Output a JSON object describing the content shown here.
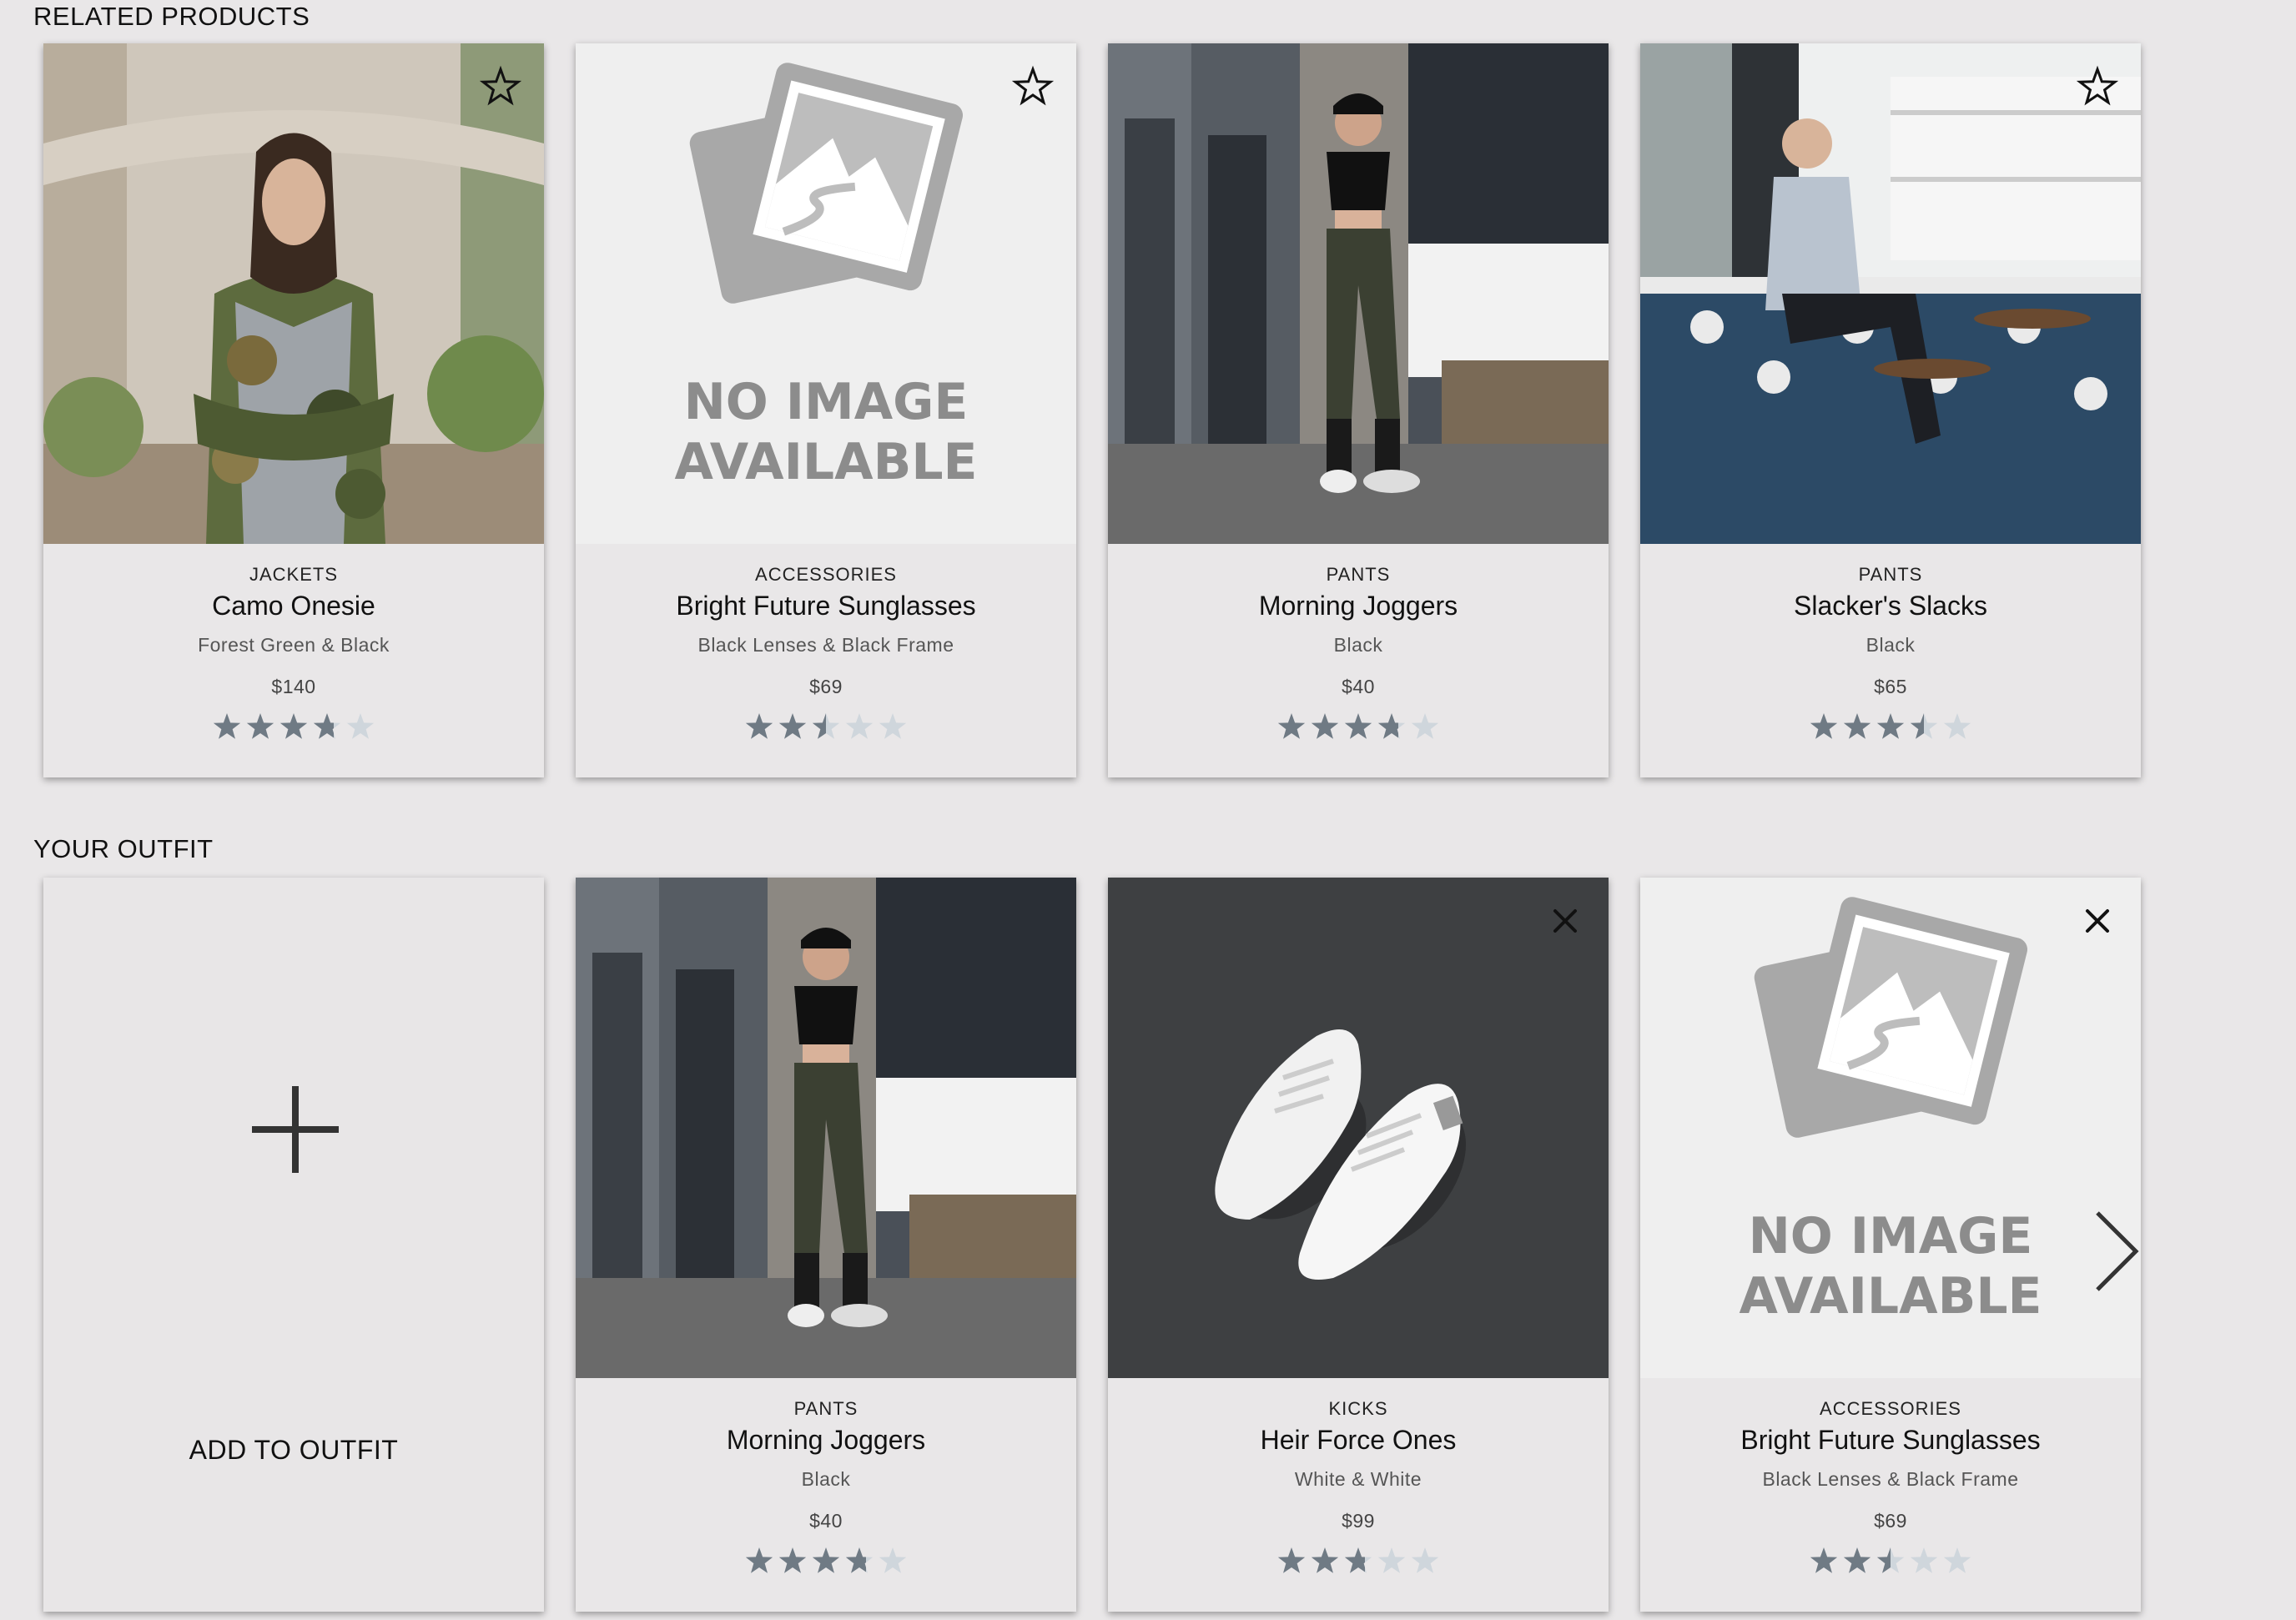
{
  "related": {
    "title": "RELATED PRODUCTS",
    "cards": [
      {
        "category": "JACKETS",
        "name": "Camo Onesie",
        "style": "Forest Green & Black",
        "price": "$140",
        "rating": 3.75,
        "action": "star-icon",
        "image": "photo-woman-camo-jacket"
      },
      {
        "category": "ACCESSORIES",
        "name": "Bright Future Sunglasses",
        "style": "Black Lenses & Black Frame",
        "price": "$69",
        "rating": 2.5,
        "action": "star-icon",
        "image": "no-image-available",
        "no_image_line1": "NO IMAGE",
        "no_image_line2": "AVAILABLE"
      },
      {
        "category": "PANTS",
        "name": "Morning Joggers",
        "style": "Black",
        "price": "$40",
        "rating": 3.75,
        "action": "none",
        "image": "photo-woman-joggers"
      },
      {
        "category": "PANTS",
        "name": "Slacker's Slacks",
        "style": "Black",
        "price": "$65",
        "rating": 3.5,
        "action": "star-icon",
        "image": "photo-man-bar-stool"
      }
    ]
  },
  "outfit": {
    "title": "YOUR OUTFIT",
    "add_label": "ADD TO OUTFIT",
    "cards": [
      {
        "category": "PANTS",
        "name": "Morning Joggers",
        "style": "Black",
        "price": "$40",
        "rating": 3.75,
        "action": "none",
        "image": "photo-woman-joggers"
      },
      {
        "category": "KICKS",
        "name": "Heir Force Ones",
        "style": "White & White",
        "price": "$99",
        "rating": 2.75,
        "action": "close-icon",
        "image": "photo-white-sneakers"
      },
      {
        "category": "ACCESSORIES",
        "name": "Bright Future Sunglasses",
        "style": "Black Lenses & Black Frame",
        "price": "$69",
        "rating": 2.5,
        "action": "close-icon",
        "image": "no-image-available",
        "no_image_line1": "NO IMAGE",
        "no_image_line2": "AVAILABLE"
      }
    ]
  },
  "colors": {
    "star_filled": "#6f7a84",
    "star_empty": "#cfd6dc",
    "background": "#e9e7e8"
  },
  "icons": {
    "next": "chevron-right-icon",
    "add": "plus-icon"
  }
}
